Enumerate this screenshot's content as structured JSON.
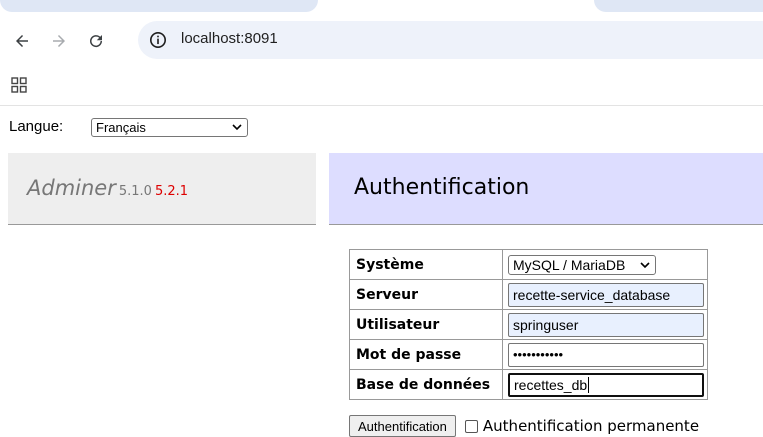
{
  "browser": {
    "url": "localhost:8091",
    "icons": {
      "back": "back-arrow-icon",
      "forward": "forward-arrow-icon",
      "reload": "reload-icon",
      "info": "info-icon",
      "apps": "apps-grid-icon"
    }
  },
  "language": {
    "label": "Langue:",
    "selected": "Français"
  },
  "adminer": {
    "name": "Adminer",
    "version": "5.1.0",
    "new_version": "5.2.1",
    "new_version_color": "#dd0000",
    "heading": "Authentification",
    "heading_bg": "#ddddff"
  },
  "login": {
    "rows": [
      {
        "label": "Système",
        "value": "MySQL / MariaDB"
      },
      {
        "label": "Serveur",
        "value": "recette-service_database"
      },
      {
        "label": "Utilisateur",
        "value": "springuser"
      },
      {
        "label": "Mot de passe",
        "value": "•••••••••••"
      },
      {
        "label": "Base de données",
        "value": "recettes_db"
      }
    ],
    "submit_label": "Authentification",
    "permanent_label": "Authentification permanente",
    "permanent_checked": false
  }
}
